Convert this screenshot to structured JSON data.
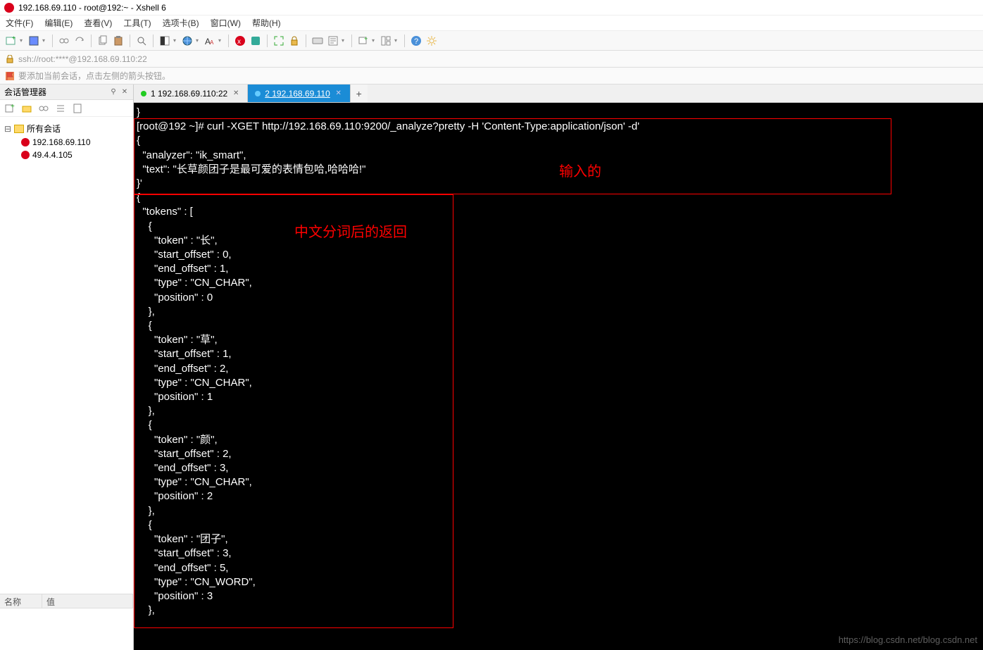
{
  "window": {
    "title": "192.168.69.110 - root@192:~ - Xshell 6"
  },
  "menus": {
    "file": "文件(F)",
    "edit": "编辑(E)",
    "view": "查看(V)",
    "tools": "工具(T)",
    "tab": "选项卡(B)",
    "window": "窗口(W)",
    "help": "帮助(H)"
  },
  "address": "ssh://root:****@192.168.69.110:22",
  "tip": "要添加当前会话，点击左侧的箭头按钮。",
  "sidebar": {
    "title": "会话管理器",
    "root": "所有会话",
    "hosts": [
      "192.168.69.110",
      "49.4.4.105"
    ],
    "col_name": "名称",
    "col_value": "值"
  },
  "tabs": {
    "t1": "1 192.168.69.110:22",
    "t2": "2 192.168.69.110"
  },
  "annotations": {
    "input": "输入的",
    "output": "中文分词后的返回"
  },
  "watermark": "https://blog.csdn.net/blog.csdn.net",
  "terminal_text": "}\n[root@192 ~]# curl -XGET http://192.168.69.110:9200/_analyze?pretty -H 'Content-Type:application/json' -d'\n{\n  \"analyzer\": \"ik_smart\",\n  \"text\": \"长草颜团子是最可爱的表情包哈,哈哈哈!\"\n}'\n{\n  \"tokens\" : [\n    {\n      \"token\" : \"长\",\n      \"start_offset\" : 0,\n      \"end_offset\" : 1,\n      \"type\" : \"CN_CHAR\",\n      \"position\" : 0\n    },\n    {\n      \"token\" : \"草\",\n      \"start_offset\" : 1,\n      \"end_offset\" : 2,\n      \"type\" : \"CN_CHAR\",\n      \"position\" : 1\n    },\n    {\n      \"token\" : \"颜\",\n      \"start_offset\" : 2,\n      \"end_offset\" : 3,\n      \"type\" : \"CN_CHAR\",\n      \"position\" : 2\n    },\n    {\n      \"token\" : \"团子\",\n      \"start_offset\" : 3,\n      \"end_offset\" : 5,\n      \"type\" : \"CN_WORD\",\n      \"position\" : 3\n    },"
}
